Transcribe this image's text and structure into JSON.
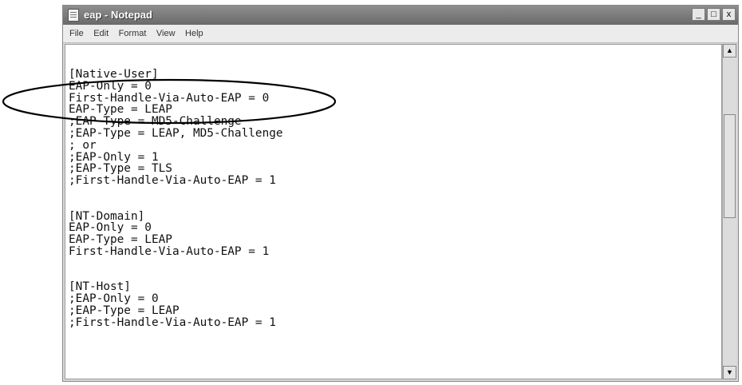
{
  "window": {
    "title": "eap - Notepad",
    "buttons": [
      "_",
      "□",
      "x"
    ]
  },
  "menu": [
    "File",
    "Edit",
    "Format",
    "View",
    "Help"
  ],
  "editor": {
    "lines": [
      "[Native-User]",
      "EAP-Only = 0",
      "First-Handle-Via-Auto-EAP = 0",
      "EAP-Type = LEAP",
      ";EAP-Type = MD5-Challenge",
      ";EAP-Type = LEAP, MD5-Challenge",
      "; or",
      ";EAP-Only = 1",
      ";EAP-Type = TLS",
      ";First-Handle-Via-Auto-EAP = 1",
      "",
      "",
      "[NT-Domain]",
      "EAP-Only = 0",
      "EAP-Type = LEAP",
      "First-Handle-Via-Auto-EAP = 1",
      "",
      "",
      "[NT-Host]",
      ";EAP-Only = 0",
      ";EAP-Type = LEAP",
      ";First-Handle-Via-Auto-EAP = 1"
    ],
    "highlighted_line": "First-Handle-Via-Auto-EAP = 0"
  },
  "scrollbar": {
    "up_arrow": "▲",
    "down_arrow": "▼"
  },
  "icons": {
    "app": "notepad-icon"
  },
  "colors": {
    "titlebar": "#7a7a7a",
    "callout": "#000000"
  }
}
